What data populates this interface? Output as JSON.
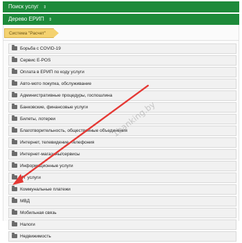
{
  "nav": {
    "search_label": "Поиск услуг",
    "tree_label": "Дерево ЕРИП",
    "caret": "⇕"
  },
  "breadcrumb": {
    "label": "Система \"Расчет\""
  },
  "categories": [
    "Борьба с COVID-19",
    "Сервис E-POS",
    "Оплата в ЕРИП по коду услуги",
    "Авто-мото покупка, обслуживание",
    "Административные процедуры, госпошлина",
    "Банковские, финансовые услуги",
    "Билеты, лотереи",
    "Благотворительность, общественные объединения",
    "Интернет, телевидение, телефония",
    "Интернет-магазины/сервисы",
    "Информационные услуги",
    "ИТ услуги",
    "Коммунальные платежи",
    "МВД",
    "Мобильная связь",
    "Налоги",
    "Недвижимость"
  ],
  "watermark": "1banking.by",
  "colors": {
    "nav_bg": "#1d8a3a",
    "crumb_bg": "#f4d270",
    "arrow": "#e53935"
  }
}
